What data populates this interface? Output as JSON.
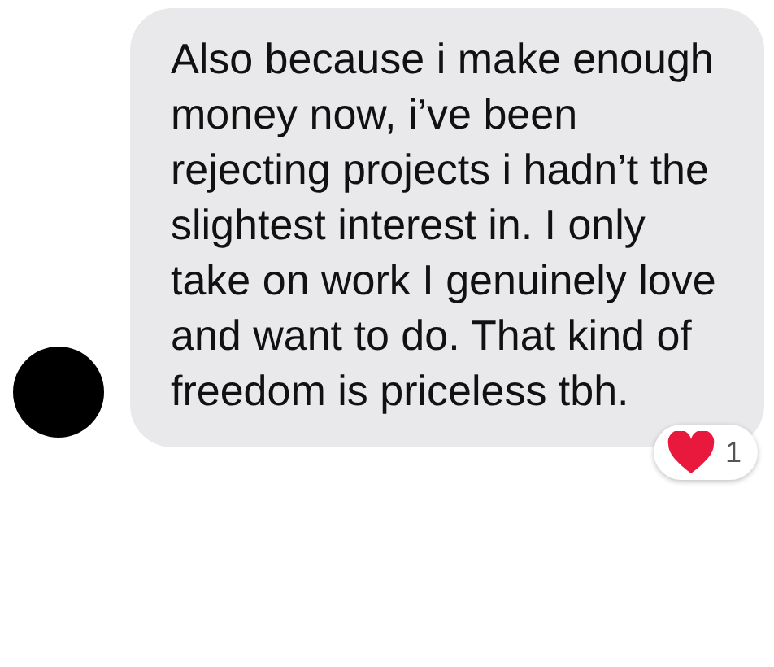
{
  "message": {
    "text": "Also because i make enough money now, i’ve been rejecting projects i hadn’t the slightest interest in. I only take on work I genuinely love and want to do. That kind of freedom is priceless tbh.",
    "reaction": {
      "count": "1"
    }
  }
}
